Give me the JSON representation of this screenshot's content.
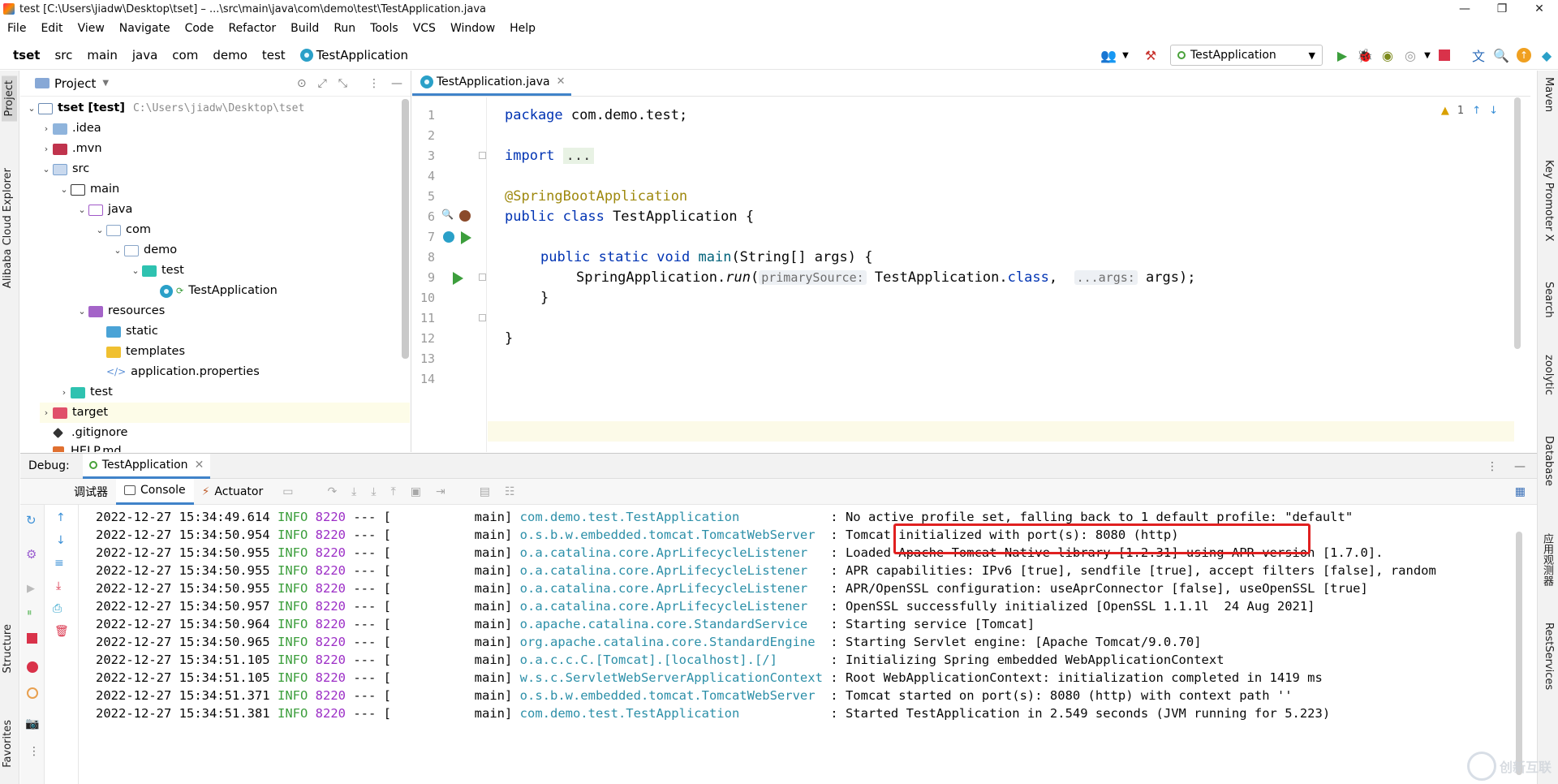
{
  "window": {
    "title": "test [C:\\Users\\jiadw\\Desktop\\tset] – ...\\src\\main\\java\\com\\demo\\test\\TestApplication.java",
    "controls": [
      "—",
      "❐",
      "✕"
    ]
  },
  "menu": [
    "File",
    "Edit",
    "View",
    "Navigate",
    "Code",
    "Refactor",
    "Build",
    "Run",
    "Tools",
    "VCS",
    "Window",
    "Help"
  ],
  "breadcrumb": [
    "tset",
    "src",
    "main",
    "java",
    "com",
    "demo",
    "test",
    "TestApplication"
  ],
  "run_config": "TestApplication",
  "left_stripe": {
    "project": "Project",
    "alibaba": "Alibaba Cloud Explorer",
    "structure": "Structure",
    "favorites": "Favorites"
  },
  "right_stripe": {
    "maven": "Maven",
    "key_promoter": "Key Promoter X",
    "search": "Search",
    "zoolytic": "zoolytic",
    "database": "Database",
    "app_scan": "应用观测器",
    "rest": "RestServices"
  },
  "project_panel": {
    "title": "Project",
    "tree": [
      {
        "label": "tset [test]",
        "path": "C:\\Users\\jiadw\\Desktop\\tset"
      },
      {
        "label": ".idea"
      },
      {
        "label": ".mvn"
      },
      {
        "label": "src"
      },
      {
        "label": "main"
      },
      {
        "label": "java"
      },
      {
        "label": "com"
      },
      {
        "label": "demo"
      },
      {
        "label": "test"
      },
      {
        "label": "TestApplication"
      },
      {
        "label": "resources"
      },
      {
        "label": "static"
      },
      {
        "label": "templates"
      },
      {
        "label": "application.properties"
      },
      {
        "label": "test"
      },
      {
        "label": "target"
      },
      {
        "label": ".gitignore"
      },
      {
        "label": "HELP.md"
      }
    ]
  },
  "editor": {
    "tab": "TestApplication.java",
    "warning_count": "1",
    "line_numbers": [
      "1",
      "2",
      "3",
      "4",
      "5",
      "6",
      "7",
      "8",
      "9",
      "10",
      "11",
      "12",
      "13",
      "14"
    ],
    "code": {
      "l1_kw": "package",
      "l1_rest": " com.demo.test;",
      "l3_kw": "import",
      "l3_fold": "...",
      "l6_ann": "@SpringBootApplication",
      "l7_kw": "public class",
      "l7_rest": " TestApplication {",
      "l9_kw": "public static void",
      "l9_fn": "main",
      "l9_rest": "(String[] args) {",
      "l10_a": "SpringApplication.",
      "l10_fn": "run",
      "l10_b": "(",
      "l10_hint1": "primarySource:",
      "l10_c": " TestApplication.",
      "l10_kw": "class",
      "l10_d": ", ",
      "l10_hint2": "...args:",
      "l10_e": " args);",
      "l11": "}",
      "l13": "}"
    }
  },
  "debug": {
    "label": "Debug:",
    "tab": "TestApplication",
    "subtabs": [
      "调试器",
      "Console",
      "Actuator"
    ]
  },
  "console_lines": [
    {
      "ts": "2022-12-27 15:34:49.614",
      "level": "INFO",
      "pid": "8220",
      "sep": "---",
      "thread": "[           main]",
      "logger": "com.demo.test.TestApplication           ",
      "msg": ": No active profile set, falling back to 1 default profile: \"default\""
    },
    {
      "ts": "2022-12-27 15:34:50.954",
      "level": "INFO",
      "pid": "8220",
      "sep": "---",
      "thread": "[           main]",
      "logger": "o.s.b.w.embedded.tomcat.TomcatWebServer ",
      "msg": ": Tomcat initialized with port(s): 8080 (http)"
    },
    {
      "ts": "2022-12-27 15:34:50.955",
      "level": "INFO",
      "pid": "8220",
      "sep": "---",
      "thread": "[           main]",
      "logger": "o.a.catalina.core.AprLifecycleListener  ",
      "msg": ": Loaded Apache Tomcat Native library [1.2.31] using APR version [1.7.0]."
    },
    {
      "ts": "2022-12-27 15:34:50.955",
      "level": "INFO",
      "pid": "8220",
      "sep": "---",
      "thread": "[           main]",
      "logger": "o.a.catalina.core.AprLifecycleListener  ",
      "msg": ": APR capabilities: IPv6 [true], sendfile [true], accept filters [false], random"
    },
    {
      "ts": "2022-12-27 15:34:50.955",
      "level": "INFO",
      "pid": "8220",
      "sep": "---",
      "thread": "[           main]",
      "logger": "o.a.catalina.core.AprLifecycleListener  ",
      "msg": ": APR/OpenSSL configuration: useAprConnector [false], useOpenSSL [true]"
    },
    {
      "ts": "2022-12-27 15:34:50.957",
      "level": "INFO",
      "pid": "8220",
      "sep": "---",
      "thread": "[           main]",
      "logger": "o.a.catalina.core.AprLifecycleListener  ",
      "msg": ": OpenSSL successfully initialized [OpenSSL 1.1.1l  24 Aug 2021]"
    },
    {
      "ts": "2022-12-27 15:34:50.964",
      "level": "INFO",
      "pid": "8220",
      "sep": "---",
      "thread": "[           main]",
      "logger": "o.apache.catalina.core.StandardService  ",
      "msg": ": Starting service [Tomcat]"
    },
    {
      "ts": "2022-12-27 15:34:50.965",
      "level": "INFO",
      "pid": "8220",
      "sep": "---",
      "thread": "[           main]",
      "logger": "org.apache.catalina.core.StandardEngine ",
      "msg": ": Starting Servlet engine: [Apache Tomcat/9.0.70]"
    },
    {
      "ts": "2022-12-27 15:34:51.105",
      "level": "INFO",
      "pid": "8220",
      "sep": "---",
      "thread": "[           main]",
      "logger": "o.a.c.c.C.[Tomcat].[localhost].[/]      ",
      "msg": ": Initializing Spring embedded WebApplicationContext"
    },
    {
      "ts": "2022-12-27 15:34:51.105",
      "level": "INFO",
      "pid": "8220",
      "sep": "---",
      "thread": "[           main]",
      "logger": "w.s.c.ServletWebServerApplicationContext",
      "msg": ": Root WebApplicationContext: initialization completed in 1419 ms"
    },
    {
      "ts": "2022-12-27 15:34:51.371",
      "level": "INFO",
      "pid": "8220",
      "sep": "---",
      "thread": "[           main]",
      "logger": "o.s.b.w.embedded.tomcat.TomcatWebServer ",
      "msg": ": Tomcat started on port(s): 8080 (http) with context path ''"
    },
    {
      "ts": "2022-12-27 15:34:51.381",
      "level": "INFO",
      "pid": "8220",
      "sep": "---",
      "thread": "[           main]",
      "logger": "com.demo.test.TestApplication           ",
      "msg": ": Started TestApplication in 2.549 seconds (JVM running for 5.223)"
    }
  ],
  "watermark": "创新互联",
  "colors": {
    "accent": "#4083c9",
    "run_green": "#3c9e3c",
    "highlight_red": "#e02020"
  }
}
